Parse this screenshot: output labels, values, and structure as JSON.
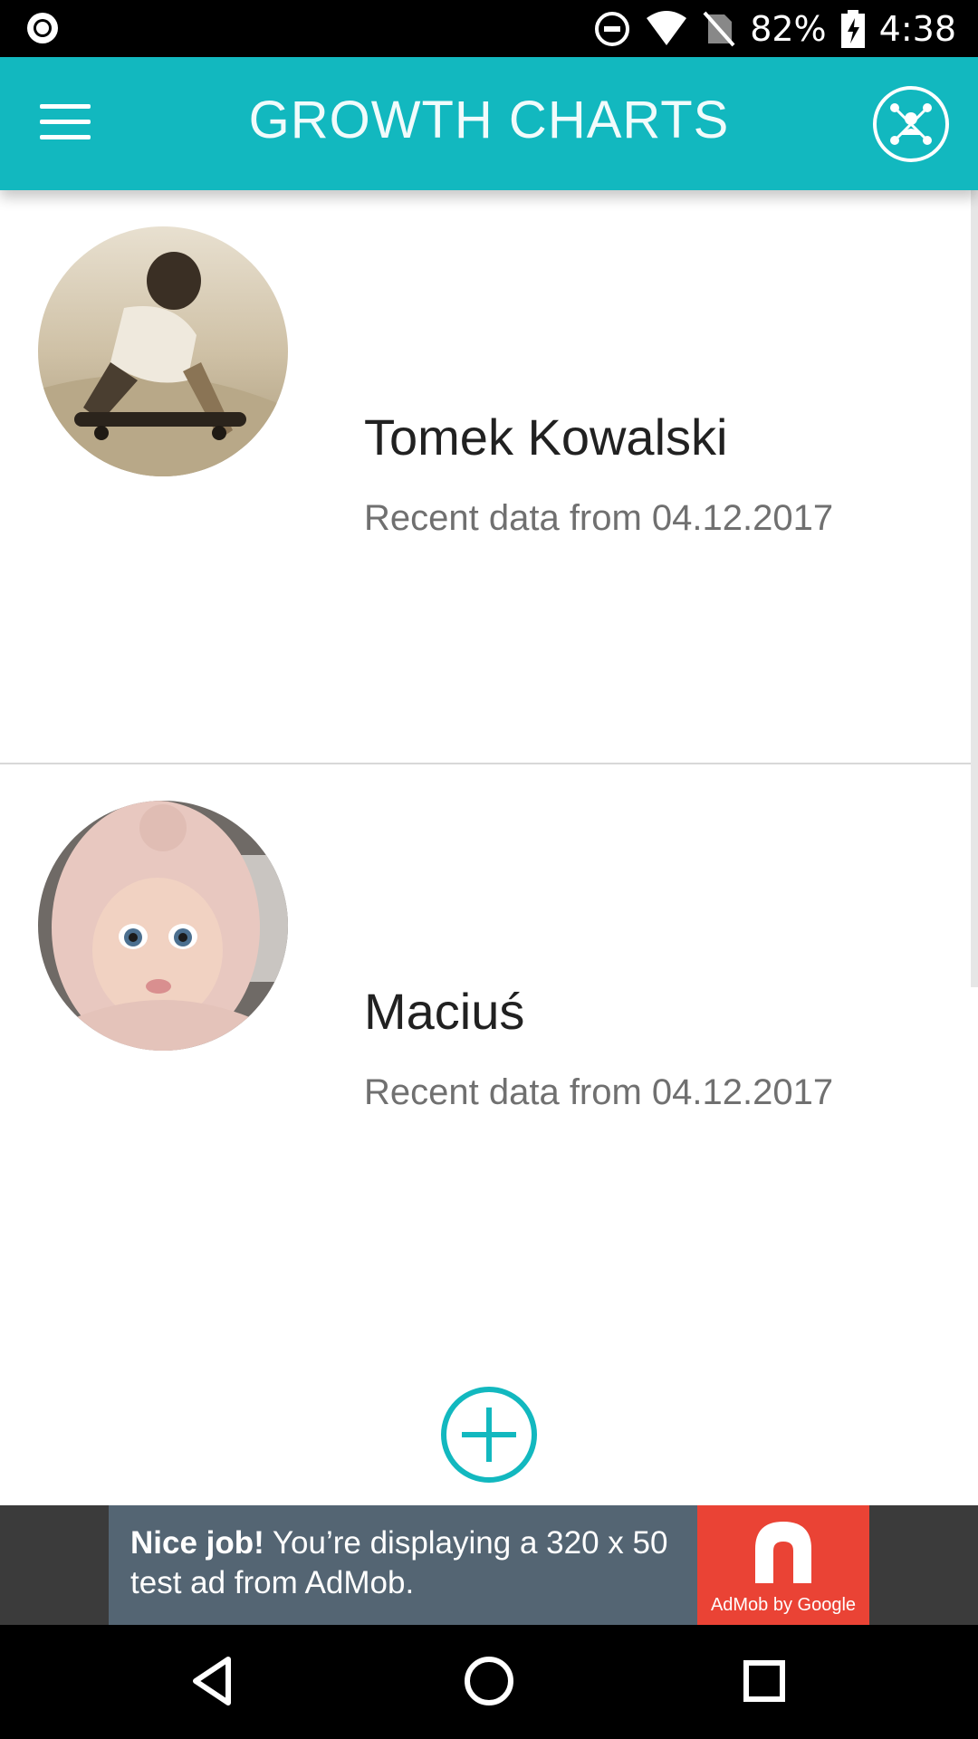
{
  "status_bar": {
    "battery": "82%",
    "time": "4:38"
  },
  "app_bar": {
    "title": "GROWTH CHARTS",
    "menu_icon": "hamburger-menu-icon",
    "share_icon": "network-share-icon"
  },
  "children": [
    {
      "name": "Tomek Kowalski",
      "subtitle": "Recent data from 04.12.2017",
      "avatar": "boy-on-skateboard-photo"
    },
    {
      "name": "Maciuś",
      "subtitle": "Recent data from 04.12.2017",
      "avatar": "baby-in-knit-hat-photo"
    }
  ],
  "add_button_icon": "add-circle-icon",
  "ad": {
    "bold": "Nice job!",
    "text": " You’re displaying a 320 x 50 test ad from AdMob.",
    "logo_caption": "AdMob by Google"
  },
  "colors": {
    "accent": "#12b8bf",
    "ad_red": "#ea4335"
  }
}
